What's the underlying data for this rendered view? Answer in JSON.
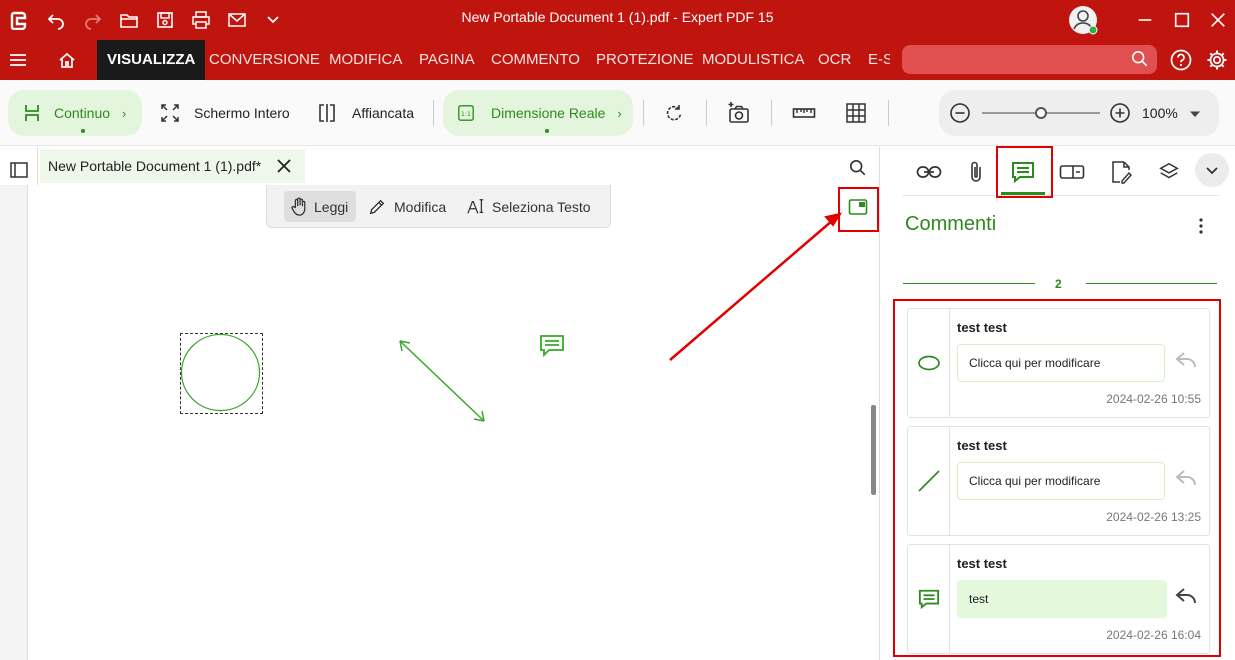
{
  "window": {
    "title": "New Portable Document 1 (1).pdf   -   Expert PDF 15"
  },
  "menu": {
    "tabs": [
      "VISUALIZZA",
      "CONVERSIONE",
      "MODIFICA",
      "PAGINA",
      "COMMENTO",
      "PROTEZIONE",
      "MODULISTICA",
      "OCR",
      "E-S"
    ],
    "active": "VISUALIZZA"
  },
  "toolbar": {
    "continuous": "Continuo",
    "fullscreen": "Schermo Intero",
    "side_by_side": "Affiancata",
    "actual_size": "Dimensione Reale",
    "zoom": "100%"
  },
  "document": {
    "tab_name": "New Portable Document 1 (1).pdf*",
    "modes": [
      "Leggi",
      "Modifica",
      "Seleziona Testo"
    ],
    "active_mode": "Leggi"
  },
  "comments_panel": {
    "title": "Commenti",
    "count": "2",
    "cards": [
      {
        "icon": "ellipse-icon",
        "author": "test test",
        "text": "Clicca qui per modificare",
        "date": "2024-02-26 10:55"
      },
      {
        "icon": "line-icon",
        "author": "test test",
        "text": "Clicca qui per modificare",
        "date": "2024-02-26 13:25"
      },
      {
        "icon": "note-icon",
        "author": "test test",
        "text": "test",
        "date": "2024-02-26 16:04"
      }
    ]
  },
  "colors": {
    "brand_red": "#c0150f",
    "accent_green": "#2e8a1e",
    "highlight_red": "#e00000"
  }
}
